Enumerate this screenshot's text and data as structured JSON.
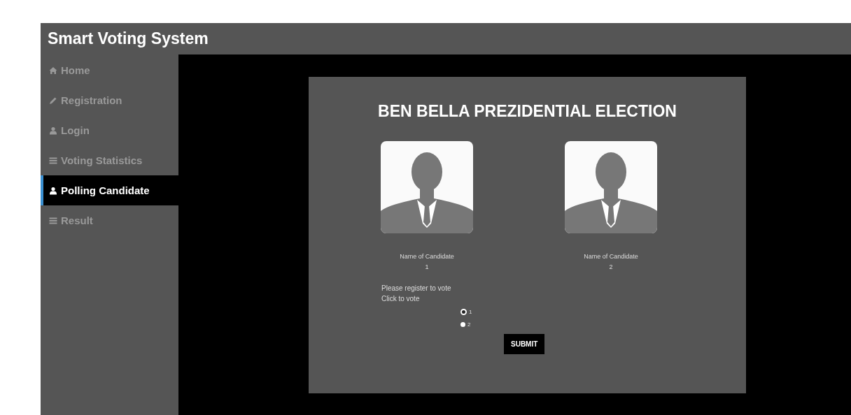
{
  "header": {
    "title": "Smart Voting System"
  },
  "sidebar": {
    "items": [
      {
        "label": "Home",
        "kind": "home",
        "selected": false
      },
      {
        "label": "Registration",
        "kind": "edit",
        "selected": false
      },
      {
        "label": "Login",
        "kind": "account",
        "selected": false
      },
      {
        "label": "Voting Statistics",
        "kind": "table",
        "selected": false
      },
      {
        "label": "Polling Candidate",
        "kind": "account",
        "selected": true
      },
      {
        "label": "Result",
        "kind": "table",
        "selected": false
      }
    ]
  },
  "ballot": {
    "title": "BEN BELLA PREZIDENTIAL ELECTION",
    "candidates": [
      {
        "name": "Name of Candidate",
        "number": "1"
      },
      {
        "name": "Name of Candidate",
        "number": "2"
      }
    ],
    "notice": "Please register to vote",
    "prompt": "Click to vote",
    "options": [
      {
        "label": "1",
        "selected": true
      },
      {
        "label": "2",
        "selected": false
      }
    ],
    "submit": "SUBMIT"
  }
}
